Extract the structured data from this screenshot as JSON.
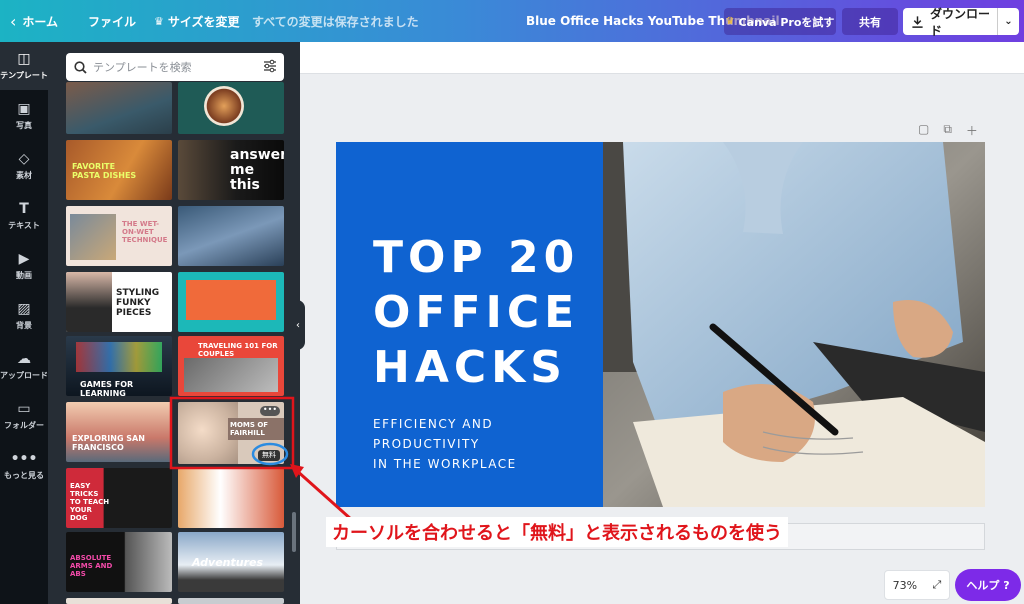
{
  "topbar": {
    "home": "ホーム",
    "file": "ファイル",
    "resize": "サイズを変更",
    "saved_status": "すべての変更は保存されました",
    "doc_title": "Blue Office Hacks YouTube Thumbnail",
    "try_pro": "Canva Proを試す",
    "share": "共有",
    "download": "ダウンロード"
  },
  "rail": {
    "templates": "テンプレート",
    "photos": "写真",
    "elements": "素材",
    "text": "テキスト",
    "videos": "動画",
    "background": "背景",
    "upload": "アップロード",
    "folders": "フォルダー",
    "more": "もっと見る"
  },
  "panel": {
    "search_placeholder": "テンプレートを検索",
    "tiles": {
      "pasta": "FAVORITE PASTA DISHES",
      "answer": "answer me this",
      "wet": "THE WET-ON-WET TECHNIQUE",
      "funky": "STYLING FUNKY PIECES",
      "games": "GAMES FOR LEARNING",
      "couples": "TRAVELING 101 FOR COUPLES",
      "sf": "EXPLORING SAN FRANCISCO",
      "moms": "MOMS OF FAIRHILL",
      "free_badge": "無料",
      "dog": "EASY TRICKS TO TEACH YOUR DOG",
      "abs": "ABSOLUTE ARMS AND ABS",
      "adventures": "Adventures"
    }
  },
  "design": {
    "headline_1": "TOP 20",
    "headline_2": "OFFICE",
    "headline_3": "HACKS",
    "sub_1": "EFFICIENCY AND",
    "sub_2": "PRODUCTIVITY",
    "sub_3": "IN THE WORKPLACE"
  },
  "footer": {
    "zoom": "73%",
    "help": "ヘルプ ?"
  },
  "annotation": {
    "callout": "カーソルを合わせると「無料」と表示されるものを使う"
  },
  "colors": {
    "accent_purple": "#7d2ae8",
    "design_blue": "#0f63d1",
    "annotation_red": "#e0151b"
  }
}
